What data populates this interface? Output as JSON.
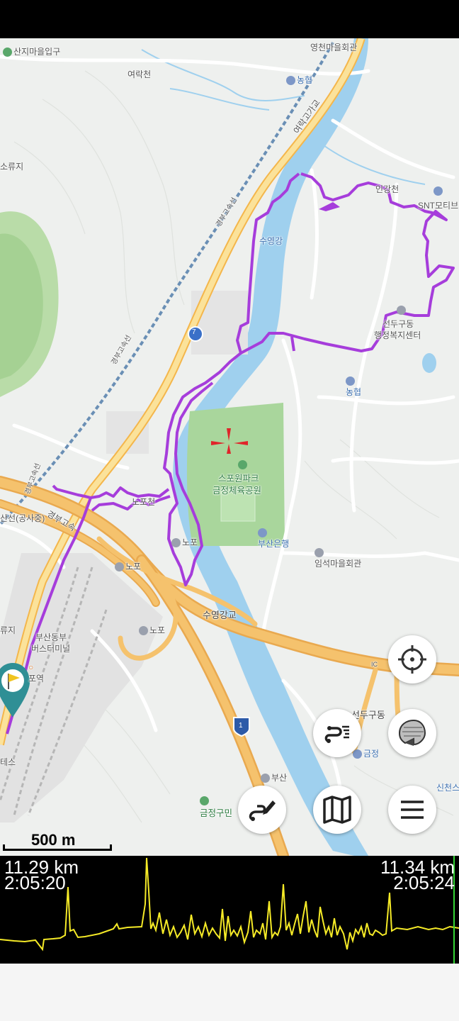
{
  "map": {
    "labels": [
      {
        "id": "sanji-entrance",
        "text": "산지마을입구"
      },
      {
        "id": "yeongcheon-hall",
        "text": "영천마을회관"
      },
      {
        "id": "yeorak-stream",
        "text": "여락천"
      },
      {
        "id": "nonghyup-top",
        "text": "농협"
      },
      {
        "id": "yeorak-overpass",
        "text": "여락고가교"
      },
      {
        "id": "soryuji",
        "text": "소류지"
      },
      {
        "id": "gyeongbu-expressway-a",
        "text": "경부고속선"
      },
      {
        "id": "ingang-stream",
        "text": "인강천"
      },
      {
        "id": "snt-motiv",
        "text": "SNT모티브"
      },
      {
        "id": "suyeong-river",
        "text": "수영강"
      },
      {
        "id": "gyeongbu-expressway-b",
        "text": "경부고속선"
      },
      {
        "id": "route-7",
        "text": "7"
      },
      {
        "id": "seondu-office-1",
        "text": "선두구동"
      },
      {
        "id": "seondu-office-2",
        "text": "행정복지센터"
      },
      {
        "id": "nonghyup-mid",
        "text": "농협"
      },
      {
        "id": "sports-park-1",
        "text": "스포원파크"
      },
      {
        "id": "sports-park-2",
        "text": "금정체육공원"
      },
      {
        "id": "gyeongbu-expressway-c",
        "text": "경부고속선"
      },
      {
        "id": "nopo-stream",
        "text": "노포천"
      },
      {
        "id": "gongsajung",
        "text": "산선(공사중)"
      },
      {
        "id": "gyeongbu-go",
        "text": "경부고속"
      },
      {
        "id": "tg-nopo-1",
        "text": "노포"
      },
      {
        "id": "busan-bank",
        "text": "부산은행"
      },
      {
        "id": "ic-nopo",
        "text": "노포"
      },
      {
        "id": "imseok-hall",
        "text": "임석마을회관"
      },
      {
        "id": "suyeong-bridge",
        "text": "수영강교"
      },
      {
        "id": "ryuji",
        "text": "류지"
      },
      {
        "id": "bus-terminal-1",
        "text": "부산동부"
      },
      {
        "id": "bus-terminal-2",
        "text": "버스터미널"
      },
      {
        "id": "tg-nopo-2",
        "text": "노포"
      },
      {
        "id": "po-station",
        "text": "포역"
      },
      {
        "id": "ic-small",
        "text": "IC"
      },
      {
        "id": "seondugu-dong",
        "text": "선두구동"
      },
      {
        "id": "route-1",
        "text": "1"
      },
      {
        "id": "geumjeong-label",
        "text": "금정"
      },
      {
        "id": "teseu",
        "text": "테스"
      },
      {
        "id": "tg-busan",
        "text": "부산"
      },
      {
        "id": "geumjeong-civic",
        "text": "금정구민"
      },
      {
        "id": "sincheon",
        "text": "신천스"
      }
    ]
  },
  "scale": {
    "label": "500 m"
  },
  "graph": {
    "left_distance": "11.29 km",
    "left_time": "2:05:20",
    "right_distance": "11.34 km",
    "right_time": "2:05:24"
  },
  "buttons": {
    "locate": "crosshair-icon",
    "layers": "layers-icon",
    "route_list": "route-list-icon",
    "route_edit": "route-edit-icon",
    "map": "map-icon",
    "menu": "menu-icon"
  },
  "colors": {
    "track": "#a63ddb",
    "expressway": "#f5c26d",
    "river": "#9fd0ee",
    "park": "#a9d69c",
    "graph_line": "#f5ea27",
    "graph_marker": "#35d635"
  }
}
